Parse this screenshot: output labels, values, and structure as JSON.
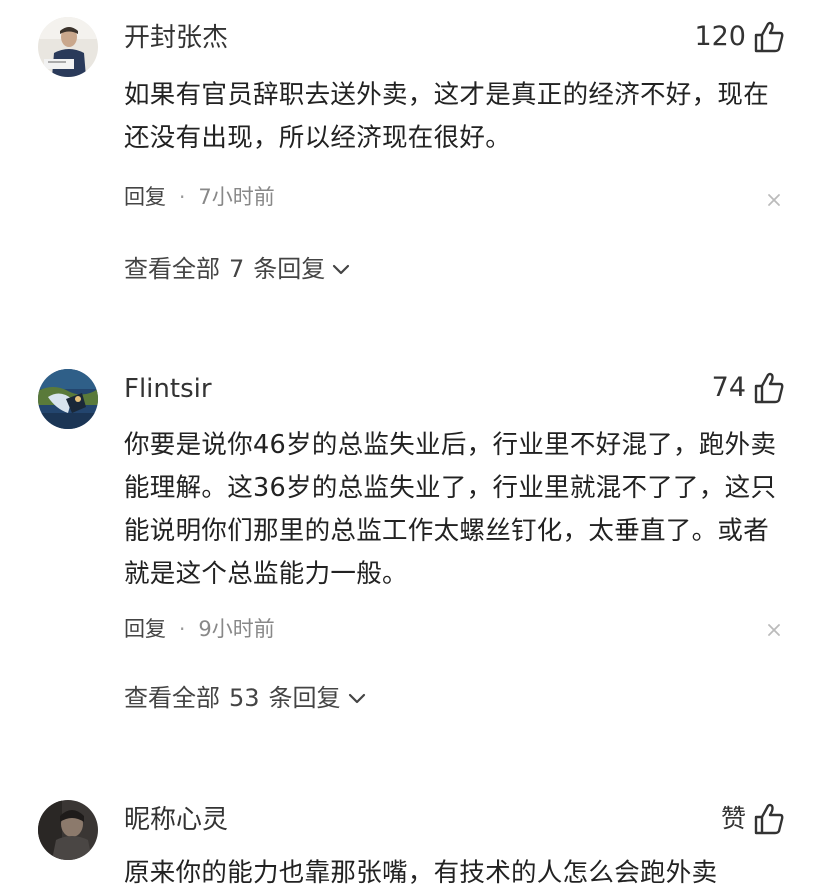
{
  "comments": [
    {
      "username": "开封张杰",
      "likes": "120",
      "text": "如果有官员辞职去送外卖，这才是真正的经济不好，现在还没有出现，所以经济现在很好。",
      "reply_label": "回复",
      "separator": "·",
      "time": "7小时前",
      "view_prefix": "查看全部",
      "view_count": "7",
      "view_suffix": "条回复",
      "avatar_icon": "person-photo-avatar"
    },
    {
      "username": "Flintsir",
      "likes": "74",
      "text": "你要是说你46岁的总监失业后，行业里不好混了，跑外卖能理解。这36岁的总监失业了，行业里就混不了了，这只能说明你们那里的总监工作太螺丝钉化，太垂直了。或者就是这个总监能力一般。",
      "reply_label": "回复",
      "separator": "·",
      "time": "9小时前",
      "view_prefix": "查看全部",
      "view_count": "53",
      "view_suffix": "条回复",
      "avatar_icon": "blue-scene-avatar"
    },
    {
      "username": "昵称心灵",
      "likes": "赞",
      "text": "原来你的能力也靠那张嘴，有技术的人怎么会跑外卖",
      "avatar_icon": "dark-portrait-avatar"
    }
  ],
  "icons": {
    "like": "thumbs-up-icon",
    "close": "close-icon",
    "expand": "chevron-down-icon"
  },
  "colors": {
    "text": "#222222",
    "meta": "#888888",
    "icon": "#333333",
    "close": "#bbbbbb"
  }
}
